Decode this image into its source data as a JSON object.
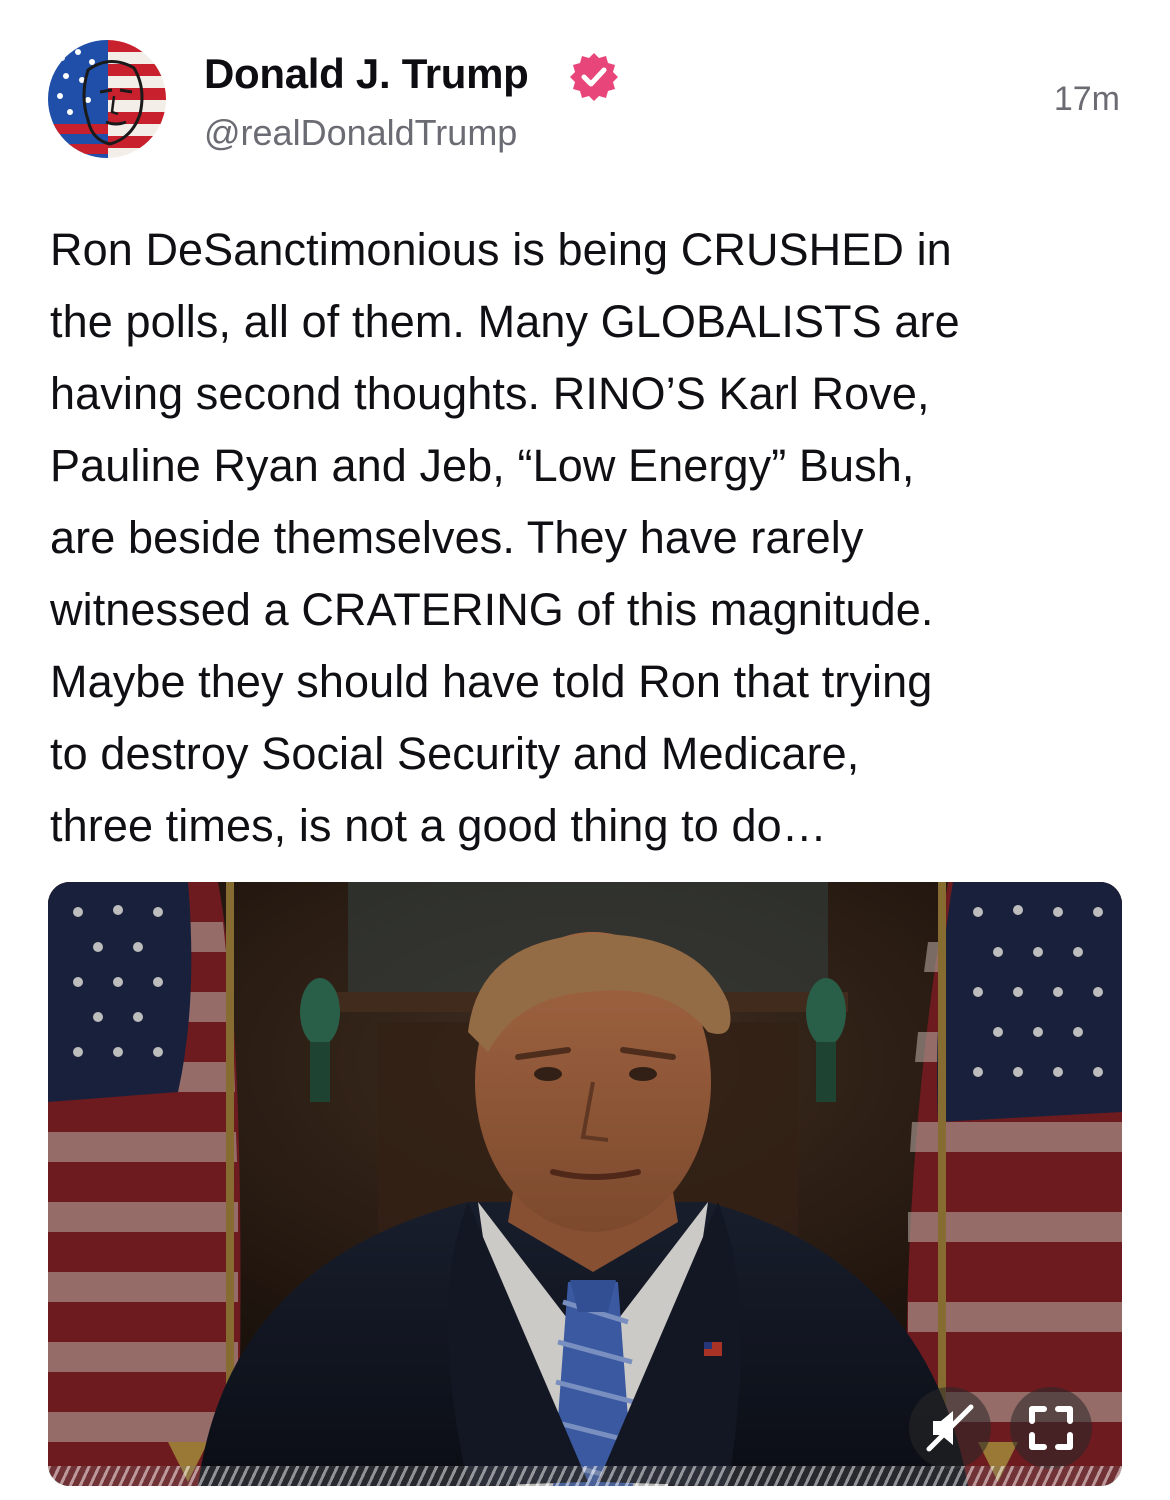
{
  "post": {
    "author": {
      "display_name": "Donald J. Trump",
      "handle": "@realDonaldTrump",
      "verified": true,
      "verified_color": "#e8467a"
    },
    "timestamp": "17m",
    "text_lines": [
      "Ron DeSanctimonious is being CRUSHED in",
      "the polls, all of them. Many GLOBALISTS are",
      "having second thoughts. RINO’S Karl Rove,",
      "Pauline Ryan and Jeb, “Low Energy” Bush,",
      "are beside themselves. They have rarely",
      "witnessed a CRATERING of this magnitude.",
      "Maybe they should have told Ron that trying",
      "to destroy Social Security and Medicare,",
      "three times, is not a good thing to do…"
    ],
    "media": {
      "type": "video",
      "muted": true,
      "controls": [
        "mute-icon",
        "fullscreen-icon"
      ]
    }
  }
}
